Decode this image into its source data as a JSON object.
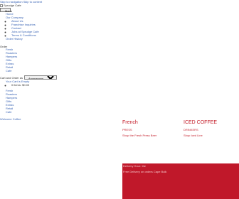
{
  "header": {
    "skip_link": "Skip to navigation Skip to content",
    "logo_alt": "Sprudge Cafe",
    "menu_button": "Menu"
  },
  "main_nav": {
    "items": [
      {
        "label": "Home"
      },
      {
        "label": "Our Company",
        "children": [
          {
            "label": "About Us"
          },
          {
            "label": "Franchise Inquiries"
          },
          {
            "label": "Contact"
          },
          {
            "label": "Jobs at Sprudge Cafe"
          },
          {
            "label": "Terms & Conditions"
          }
        ]
      },
      {
        "label": "Order History"
      }
    ]
  },
  "order_label": "Order",
  "order_nav": [
    "Fresh",
    "Roasters",
    "Hampers",
    "Gifts",
    "Extras",
    "Retail",
    "Cafe"
  ],
  "cart": {
    "label": "Cart and Order as",
    "select_value": "Anonymous",
    "summary": "Your Cart is Empty",
    "sub_item": "0 items: $0.00"
  },
  "shop_nav": [
    "Fresh",
    "Roasters",
    "Hampers",
    "Gifts",
    "Extras",
    "Retail",
    "Cafe"
  ],
  "welcome": "Welcome Coffee",
  "cards": {
    "french": {
      "title": "French",
      "subtitle": "PRESS",
      "link": "Shop the Fresh Press Beer"
    },
    "iced": {
      "title": "ICED COFFEE",
      "subtitle": "DRINKERS",
      "link": "Shop Iced Line"
    }
  },
  "banner": {
    "title": "Delivery Hour: the",
    "subtitle": "Free Delivery on orders Cape Bulk"
  },
  "colors": {
    "brand_red": "#c0182a",
    "link_blue": "#3a64b4"
  }
}
